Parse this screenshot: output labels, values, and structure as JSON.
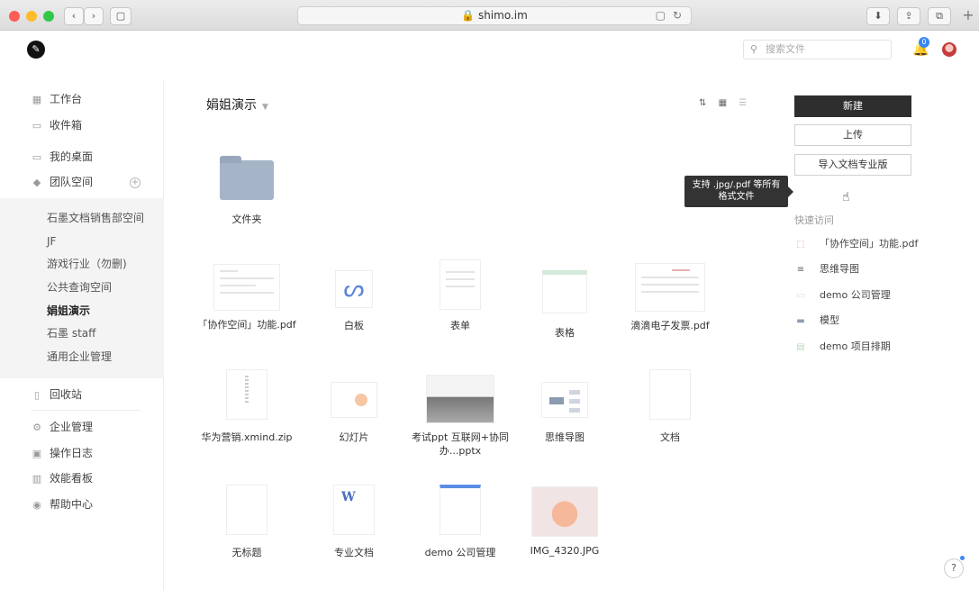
{
  "browser": {
    "url": "🔒 shimo.im",
    "nav_back": "‹",
    "nav_forward": "›",
    "sidebar_toggle": "▢",
    "reader": "▢",
    "reload": "↻",
    "download": "⬇",
    "share": "⇪",
    "tabs": "⧉",
    "new_tab": "+"
  },
  "topbar": {
    "logo": "✎",
    "search_placeholder": "搜索文件",
    "search_icon": "⚲",
    "notification_count": "0",
    "bell": "🔔"
  },
  "sidebar": {
    "nav": [
      {
        "icon": "▦",
        "label": "工作台"
      },
      {
        "icon": "▭",
        "label": "收件箱"
      },
      {
        "icon": "▭",
        "label": "我的桌面"
      },
      {
        "icon": "◆",
        "label": "团队空间"
      }
    ],
    "team_add": "+",
    "teams": [
      "石墨文档销售部空间",
      "JF",
      "游戏行业（勿删)",
      "公共查询空间",
      "娟姐演示",
      "石墨 staff",
      "通用企业管理"
    ],
    "bottom": [
      {
        "icon": "▯",
        "label": "回收站"
      },
      {
        "icon": "⚙",
        "label": "企业管理"
      },
      {
        "icon": "▣",
        "label": "操作日志"
      },
      {
        "icon": "▥",
        "label": "效能看板"
      },
      {
        "icon": "◉",
        "label": "帮助中心"
      }
    ]
  },
  "main": {
    "title": "娟姐演示",
    "title_caret": "▼",
    "sort_icon": "⇅",
    "grid_icon": "▦",
    "list_icon": "☰",
    "files": [
      {
        "name": "文件夹",
        "kind": "folder"
      },
      {
        "name": "「协作空间」功能.pdf",
        "kind": "pdf"
      },
      {
        "name": "白板",
        "kind": "board"
      },
      {
        "name": "表单",
        "kind": "form"
      },
      {
        "name": "表格",
        "kind": "sheet"
      },
      {
        "name": "滴滴电子发票.pdf",
        "kind": "invoice"
      },
      {
        "name": "华为营销.xmind.zip",
        "kind": "zip"
      },
      {
        "name": "幻灯片",
        "kind": "slides"
      },
      {
        "name": "考试ppt 互联网+协同办...pptx",
        "kind": "pptx"
      },
      {
        "name": "思维导图",
        "kind": "mind"
      },
      {
        "name": "文档",
        "kind": "doc"
      },
      {
        "name": "无标题",
        "kind": "doc"
      },
      {
        "name": "专业文档",
        "kind": "word"
      },
      {
        "name": "demo 公司管理",
        "kind": "doc"
      },
      {
        "name": "IMG_4320.JPG",
        "kind": "image"
      }
    ]
  },
  "panel": {
    "new": "新建",
    "upload": "上传",
    "import_pro": "导入文档专业版",
    "tooltip_line1": "支持 .jpg/.pdf 等所有",
    "tooltip_line2": "格式文件",
    "quick_access_title": "快速访问",
    "quick": [
      {
        "icon": "⬚",
        "label": "「协作空间」功能.pdf"
      },
      {
        "icon": "≡",
        "label": "思维导图"
      },
      {
        "icon": "▭",
        "label": "demo 公司管理"
      },
      {
        "icon": "▬",
        "label": "模型"
      },
      {
        "icon": "▤",
        "label": "demo 项目排期"
      }
    ]
  },
  "help": "?",
  "colors": {
    "primary": "#2e2e2e",
    "accent": "#3b86f6",
    "folder": "#a6b4c8"
  }
}
